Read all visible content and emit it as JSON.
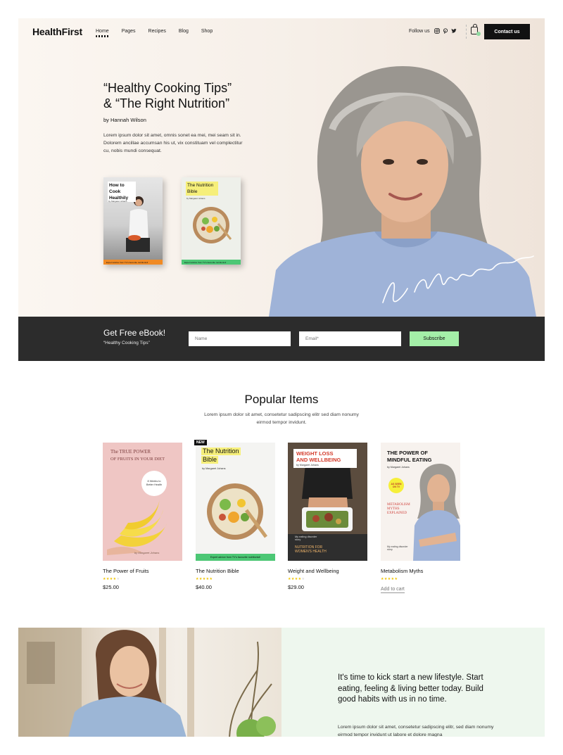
{
  "header": {
    "logo": "HealthFirst",
    "nav": [
      "Home",
      "Pages",
      "Recipes",
      "Blog",
      "Shop"
    ],
    "follow_label": "Follow us",
    "social_icons": [
      "instagram-icon",
      "pinterest-icon",
      "twitter-icon"
    ],
    "contact_label": "Contact us"
  },
  "hero": {
    "title_line1": "“Healthy Cooking Tips”",
    "title_line2": "& “The Right Nutrition”",
    "author": "by Hannah Wilson",
    "description": "Lorem ipsum dolor sit amet, omnis sonet ea mei, mei seam sit in. Dolorem ancillae accumsan his ut, vix constituam vel complectitur cu, nobis mundi consequat.",
    "books": [
      {
        "title": "How to Cook Healthily",
        "author": "by Margaret Johans",
        "band": "Expert advice from TV's favourite nutritionist!"
      },
      {
        "title": "The Nutrition Bible",
        "author": "by Margaret Johans",
        "band": "Expert advice from TV's favourite nutritionist!"
      }
    ],
    "signature": "by Margaret"
  },
  "ebook": {
    "title": "Get Free eBook!",
    "subtitle": "“Healthy Cooking Tips”",
    "name_placeholder": "Name",
    "email_placeholder": "Email*",
    "subscribe_label": "Subscribe"
  },
  "popular": {
    "title": "Popular Items",
    "description": "Lorem ipsum dolor sit amet, consetetur sadipscing elitr sed diam nonumy eirmod tempor invidunt.",
    "items": [
      {
        "name": "The Power of Fruits",
        "rating": 4,
        "price": "$25.00",
        "badge": "",
        "cover_lines": [
          "The TRUE POWER",
          "OF FRUITS IN YOUR DIET"
        ],
        "cover_note": "8 Weeks to Better Health",
        "cover_sig": "by Margaret Johans"
      },
      {
        "name": "The Nutrition Bible",
        "rating": 5,
        "price": "$40.00",
        "badge": "NEW",
        "cover_lines": [
          "The Nutrition",
          "Bible"
        ],
        "cover_note": "by Margaret Johans",
        "cover_sig": "Expert advice from TV's favourite nutritionist!"
      },
      {
        "name": "Weight and Wellbeing",
        "rating": 4,
        "price": "$29.00",
        "badge": "",
        "cover_lines": [
          "WEIGHT LOSS",
          "AND WELLBEING"
        ],
        "cover_note": "by Margaret Johans",
        "cover_sig": "NUTRITION FOR WOMEN'S HEALTH",
        "cover_extra": "My eating disorder story"
      },
      {
        "name": "Metabolism Myths",
        "rating": 5,
        "price": "",
        "badge": "",
        "action": "Add to cart",
        "cover_lines": [
          "THE POWER OF",
          "MINDFUL EATING"
        ],
        "cover_note": "by Margaret Johans",
        "cover_sig": "METABOLISM MYTHS EXPLAINED",
        "cover_extra": "My eating disorder story",
        "cover_seal": "AS SEEN ON TV"
      }
    ]
  },
  "bottom": {
    "headline": "It's time to kick start a new lifestyle. Start eating, feeling & living better today. Build good habits with us in no time.",
    "description": "Lorem ipsum dolor sit amet, consetetur sadipscing elitr, sed diam nonumy eirmod tempor invidunt ut labore et dolore magna"
  },
  "colors": {
    "dark_bar": "#2c2c2c",
    "accent_green": "#a4efa8",
    "star_yellow": "#f0c400"
  }
}
